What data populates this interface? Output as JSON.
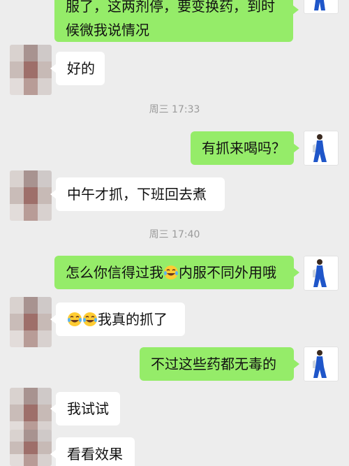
{
  "colors": {
    "background": "#ededed",
    "sent_bubble": "#95ec69",
    "received_bubble": "#ffffff",
    "timestamp": "#9a9a9a",
    "self_avatar_accent": "#1f56c9"
  },
  "messages": {
    "m1_line1": "服了，这两剂停，要变换药，到时",
    "m1_line2": "候微我说情况",
    "m2": "好的",
    "t1": "周三 17:33",
    "m3": "有抓来喝吗？",
    "m4": "中午才抓，下班回去煮",
    "t2": "周三 17:40",
    "m5_before": "怎么你信得过我",
    "m5_after": "内服不同外用哦",
    "m6": "我真的抓了",
    "m7": "不过这些药都无毒的",
    "m8": "我试试",
    "m9": "看看效果"
  },
  "icons": {
    "contact_avatar": "blurred-avatar",
    "self_avatar": "person-in-blue-avatar",
    "emoji": "tears-of-joy-emoji"
  }
}
